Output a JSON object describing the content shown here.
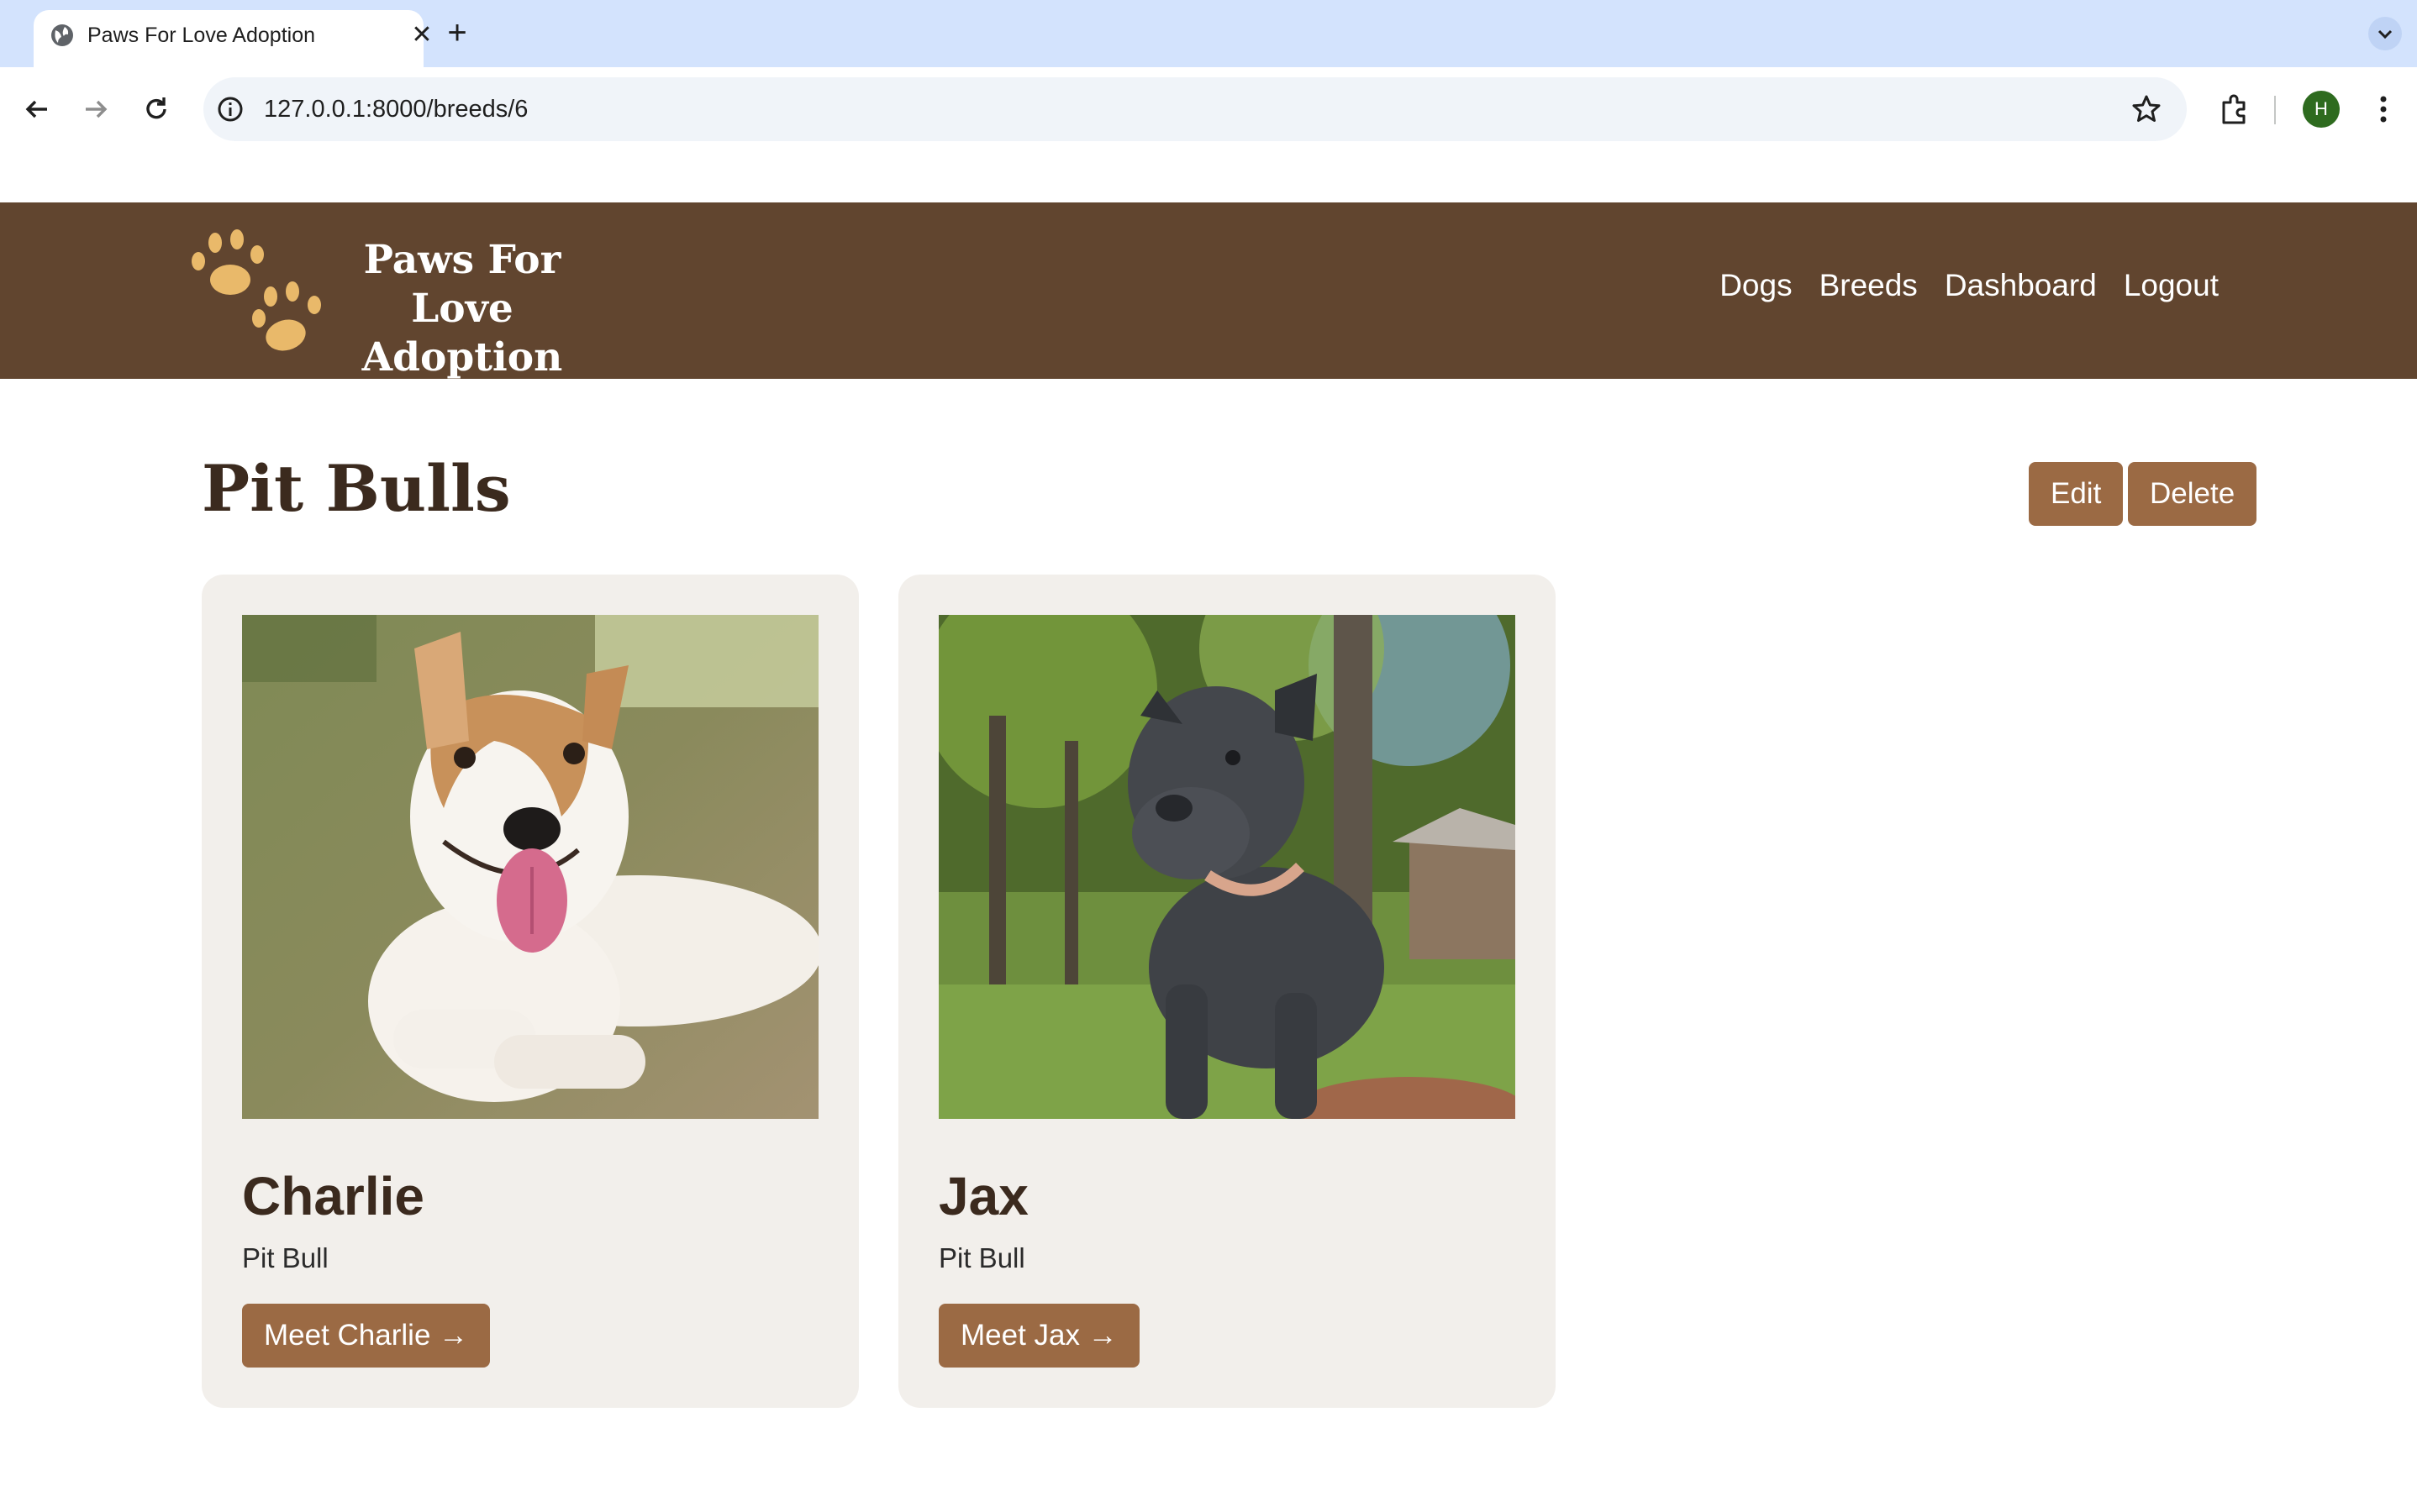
{
  "browser": {
    "tab_title": "Paws For Love Adoption",
    "url": "127.0.0.1:8000/breeds/6",
    "profile_initial": "H"
  },
  "site": {
    "logo_line1": "Paws For Love",
    "logo_line2": "Adoption",
    "nav": [
      "Dogs",
      "Breeds",
      "Dashboard",
      "Logout"
    ]
  },
  "page": {
    "title": "Pit Bulls",
    "edit_label": "Edit",
    "delete_label": "Delete"
  },
  "dogs": [
    {
      "name": "Charlie",
      "breed": "Pit Bull",
      "button": "Meet Charlie →"
    },
    {
      "name": "Jax",
      "breed": "Pit Bull",
      "button": "Meet Jax →"
    }
  ],
  "colors": {
    "header_bg": "#61452f",
    "accent_button": "#9b6a44",
    "logo_paw": "#e9b96a",
    "card_bg": "#f2efeb"
  }
}
